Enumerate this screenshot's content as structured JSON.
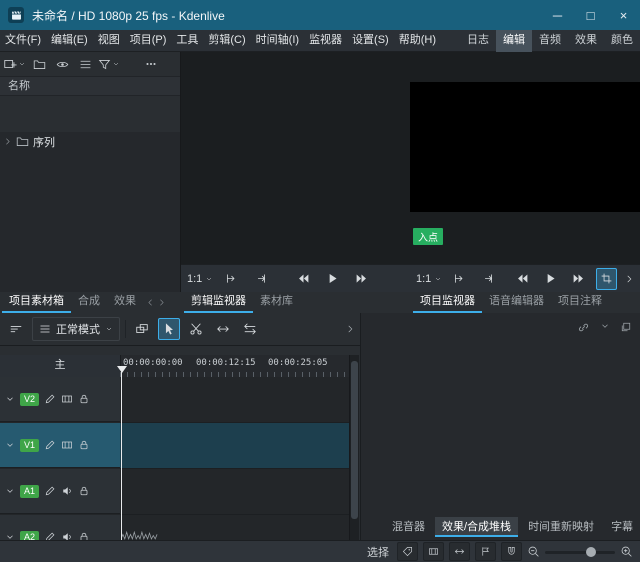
{
  "colors": {
    "accent": "#3daee9",
    "titlebar": "#19607d",
    "track_badge_green": "#3fa548",
    "in_point_green": "#27ae60",
    "active_track": "#265a70"
  },
  "window": {
    "title": "未命名 / HD 1080p 25 fps - Kdenlive"
  },
  "menubar": {
    "items": [
      {
        "label": "文件(F)"
      },
      {
        "label": "编辑(E)"
      },
      {
        "label": "视图"
      },
      {
        "label": "项目(P)"
      },
      {
        "label": "工具"
      },
      {
        "label": "剪辑(C)"
      },
      {
        "label": "时间轴(I)"
      },
      {
        "label": "监视器"
      },
      {
        "label": "设置(S)"
      },
      {
        "label": "帮助(H)"
      }
    ],
    "workspaces": [
      {
        "label": "日志",
        "active": false
      },
      {
        "label": "编辑",
        "active": true
      },
      {
        "label": "音频",
        "active": false
      },
      {
        "label": "效果",
        "active": false
      },
      {
        "label": "颜色",
        "active": false
      }
    ]
  },
  "project_bin": {
    "toolbar_icons": [
      "add-clip",
      "open-folder",
      "view-eye",
      "view-list",
      "filter",
      "overflow-menu"
    ],
    "name_header": "名称",
    "items": [
      {
        "label": "序列",
        "type": "folder"
      }
    ],
    "tabs": [
      {
        "label": "项目素材箱",
        "active": true
      },
      {
        "label": "合成",
        "active": false
      },
      {
        "label": "效果",
        "active": false
      }
    ]
  },
  "clip_monitor": {
    "zoom": "1:1",
    "toolbar_icons": [
      "mark-in",
      "mark-out",
      "rewind",
      "play",
      "forward"
    ],
    "tabs": [
      {
        "label": "剪辑监视器",
        "active": true
      },
      {
        "label": "素材库",
        "active": false
      }
    ]
  },
  "project_monitor": {
    "zoom": "1:1",
    "in_point_label": "入点",
    "toolbar_icons": [
      "mark-in",
      "mark-out",
      "rewind",
      "play",
      "forward",
      "trim"
    ],
    "tabs": [
      {
        "label": "项目监视器",
        "active": true
      },
      {
        "label": "语音编辑器",
        "active": false
      },
      {
        "label": "项目注释",
        "active": false
      }
    ]
  },
  "timeline": {
    "mode": "正常模式",
    "master_label": "主",
    "ruler": [
      "00:00:00:00",
      "00:00:12:15",
      "00:00:25:05"
    ],
    "tool_icons": [
      "timeline-menu",
      "mix",
      "selection-tool",
      "razor-tool",
      "spacer-tool",
      "slip-tool"
    ],
    "tracks": [
      {
        "id": "V2",
        "type": "video",
        "active": false
      },
      {
        "id": "V1",
        "type": "video",
        "active": true
      },
      {
        "id": "A1",
        "type": "audio",
        "active": false
      },
      {
        "id": "A2",
        "type": "audio",
        "active": false
      }
    ]
  },
  "right_panel": {
    "tabs": [
      {
        "label": "混音器",
        "active": false
      },
      {
        "label": "效果/合成堆栈",
        "active": true
      },
      {
        "label": "时间重新映射",
        "active": false
      },
      {
        "label": "字幕",
        "active": false
      }
    ]
  },
  "statusbar": {
    "tool_label": "选择",
    "buttons": [
      "tag",
      "thumbnails",
      "scroll",
      "markers",
      "snap",
      "zoom-out",
      "zoom-slider",
      "zoom-in"
    ]
  }
}
